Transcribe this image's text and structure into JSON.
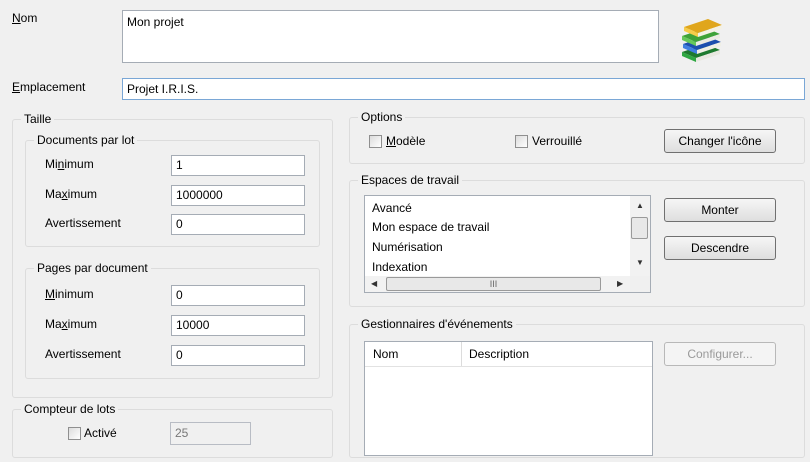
{
  "form": {
    "nom": {
      "label": "Nom",
      "value": "Mon projet"
    },
    "emplacement": {
      "label": "Emplacement",
      "value": "Projet I.R.I.S."
    }
  },
  "taille": {
    "title": "Taille",
    "documents_par_lot": {
      "title": "Documents par lot",
      "minimum_label": "Minimum",
      "minimum_value": "1",
      "maximum_label": "Maximum",
      "maximum_value": "1000000",
      "avertissement_label": "Avertissement",
      "avertissement_value": "0"
    },
    "pages_par_document": {
      "title": "Pages par document",
      "minimum_label": "Minimum",
      "minimum_value": "0",
      "maximum_label": "Maximum",
      "maximum_value": "10000",
      "avertissement_label": "Avertissement",
      "avertissement_value": "0"
    }
  },
  "compteur": {
    "title": "Compteur de lots",
    "active_label": "Activé",
    "active_checked": false,
    "value": "25"
  },
  "options": {
    "title": "Options",
    "modele_label": "Modèle",
    "modele_checked": false,
    "verrouille_label": "Verrouillé",
    "verrouille_checked": false,
    "changer_icone_label": "Changer l'icône"
  },
  "espaces": {
    "title": "Espaces de travail",
    "items": [
      "Avancé",
      "Mon espace de travail",
      "Numérisation",
      "Indexation"
    ],
    "monter_label": "Monter",
    "descendre_label": "Descendre",
    "hscroll_grip": "III"
  },
  "gestionnaires": {
    "title": "Gestionnaires d'événements",
    "columns": [
      "Nom",
      "Description"
    ],
    "configurer_label": "Configurer..."
  },
  "icons": {
    "project": "books-stack-icon"
  }
}
